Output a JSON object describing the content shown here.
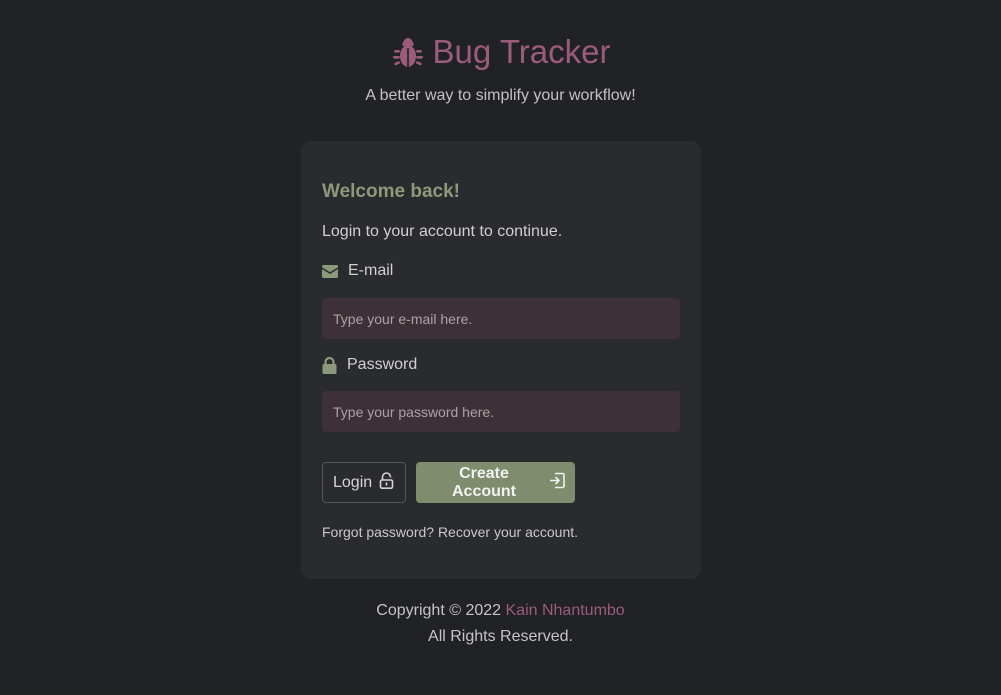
{
  "brand": {
    "title": "Bug Tracker",
    "icon": "bug-icon",
    "tagline": "A better way to simplify your workflow!",
    "color": "#9a5c7a"
  },
  "login": {
    "heading": "Welcome back!",
    "subtitle": "Login to your account to continue.",
    "email": {
      "label": "E-mail",
      "icon": "envelope-icon",
      "placeholder": "Type your e-mail here.",
      "value": ""
    },
    "password": {
      "label": "Password",
      "icon": "lock-icon",
      "placeholder": "Type your password here.",
      "value": ""
    },
    "login_button": {
      "label": "Login",
      "icon": "unlock-icon"
    },
    "create_button": {
      "label": "Create Account",
      "icon": "sign-in-icon"
    },
    "forgot_link": "Forgot password? Recover your account."
  },
  "footer": {
    "copyright": "Copyright © 2022",
    "author": "Kain Nhantumbo",
    "rights": "All Rights Reserved."
  },
  "colors": {
    "background": "#212226",
    "card": "#2a2b2f",
    "accent_green": "#7f8c6e",
    "heading_green": "#8c9a7a",
    "accent_pink": "#9a5c7a",
    "input_bg": "#3d3137"
  }
}
